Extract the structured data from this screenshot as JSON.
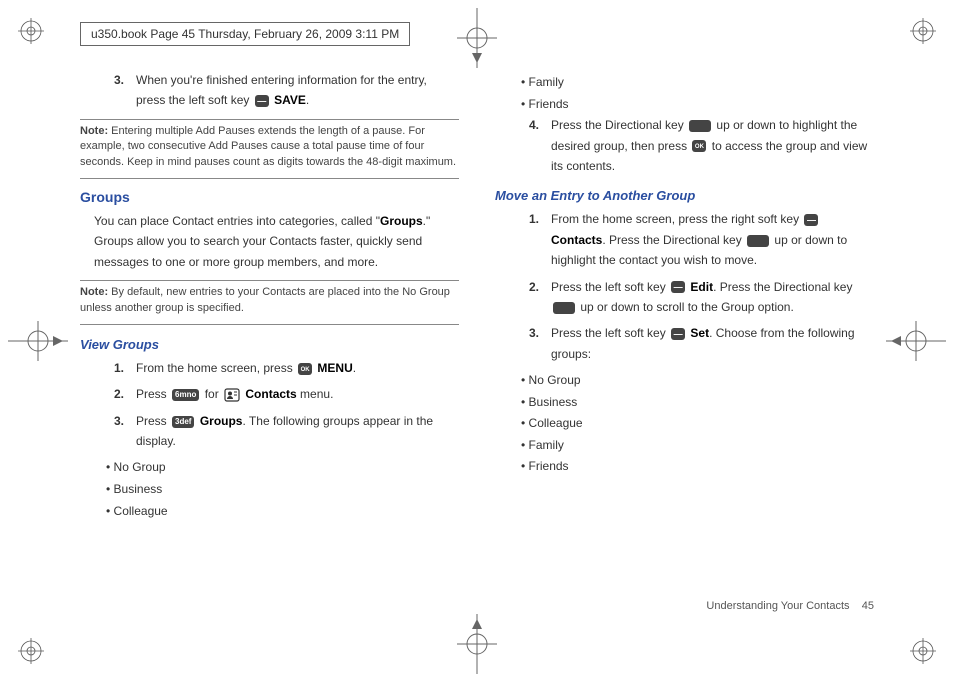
{
  "draft_header": "u350.book  Page 45  Thursday, February 26, 2009  3:11 PM",
  "left": {
    "step3_a": "When you're finished entering information for the entry, press the left soft key ",
    "step3_b": "SAVE",
    "step3_c": ".",
    "note1_label": "Note:",
    "note1_text": "Entering multiple Add Pauses extends the length of a pause. For example, two consecutive Add Pauses cause a total pause time of four seconds. Keep in mind pauses count as digits towards the 48-digit maximum.",
    "section_groups": "Groups",
    "groups_para_a": "You can place Contact entries into categories, called \"",
    "groups_para_b": "Groups",
    "groups_para_c": ".\" Groups allow you to search your Contacts faster, quickly send messages to one or more group members, and more.",
    "note2_label": "Note:",
    "note2_text": "By default, new entries to your Contacts are placed into the No Group unless another group is specified.",
    "view_groups_heading": "View Groups",
    "vg1_a": "From the home screen, press ",
    "vg1_b": "MENU",
    "vg1_c": ".",
    "vg2_a": "Press ",
    "vg2_key": "6mno",
    "vg2_b": " for ",
    "vg2_c": "Contacts",
    "vg2_d": " menu.",
    "vg3_a": "Press ",
    "vg3_key": "3def",
    "vg3_b": "Groups",
    "vg3_c": ". The following groups appear in the display.",
    "bullets_left": [
      "No Group",
      "Business",
      "Colleague"
    ]
  },
  "right": {
    "bullets_top": [
      "Family",
      "Friends"
    ],
    "step4_a": "Press the Directional key ",
    "step4_b": " up or down to highlight the desired group, then press ",
    "step4_c": " to access the group and view its contents.",
    "move_heading": "Move an Entry to Another Group",
    "m1_a": "From the home screen, press the right soft key ",
    "m1_b": "Contacts",
    "m1_c": ". Press the Directional key ",
    "m1_d": " up or down to highlight the contact you wish to move.",
    "m2_a": "Press the left soft key ",
    "m2_b": "Edit",
    "m2_c": ". Press the Directional key ",
    "m2_d": " up or down to scroll to the Group option.",
    "m3_a": "Press the left soft key ",
    "m3_b": "Set",
    "m3_c": ". Choose from the following groups:",
    "bullets_right": [
      "No Group",
      "Business",
      "Colleague",
      "Family",
      "Friends"
    ]
  },
  "footer_section": "Understanding Your Contacts",
  "footer_page": "45",
  "nums": {
    "n1": "1.",
    "n2": "2.",
    "n3": "3.",
    "n4": "4."
  }
}
